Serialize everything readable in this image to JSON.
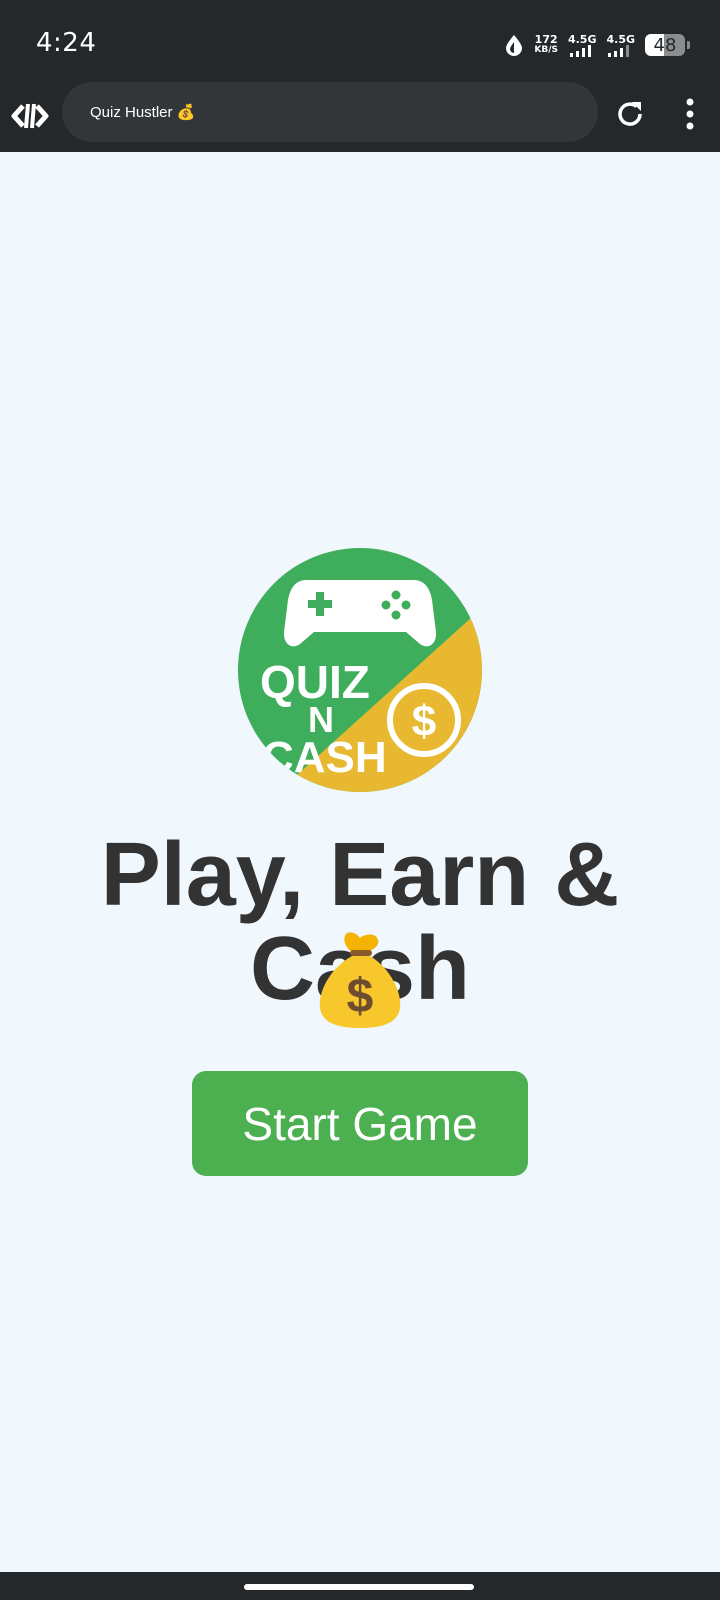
{
  "status_bar": {
    "time": "4:24",
    "net_speed_value": "172",
    "net_speed_unit": "KB/S",
    "signal1_label": "4.5G",
    "signal2_label": "4.5G",
    "battery_level": "48",
    "battery_fraction": 0.48
  },
  "browser": {
    "url_title": "Quiz Hustler 💰"
  },
  "logo": {
    "line1": "QUIZ",
    "line2": "N",
    "line3": "CASH",
    "green": "#3fae5c",
    "yellow": "#e8b830"
  },
  "main": {
    "headline": "Play, Earn & Cash",
    "start_button_label": "Start Game"
  },
  "colors": {
    "button": "#4caf50",
    "background": "#f0f7fd",
    "headline": "#333333",
    "bars": "#25282b"
  },
  "icons": [
    "app-logo-icon",
    "reload-icon",
    "more-vert-icon",
    "data-saver-icon",
    "signal-icon",
    "battery-icon",
    "gamepad-icon",
    "dollar-coin-icon",
    "money-bag-icon"
  ]
}
